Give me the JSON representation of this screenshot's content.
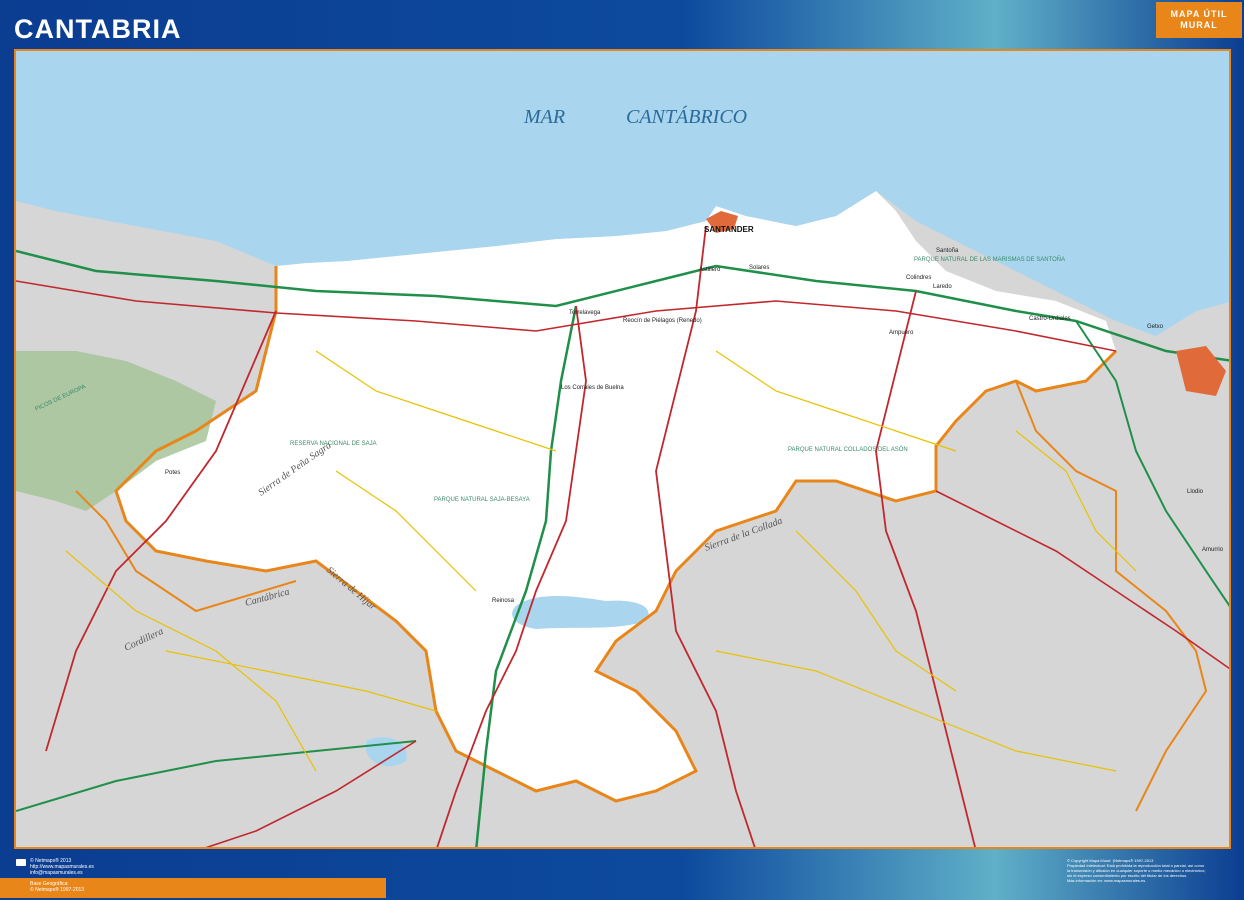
{
  "header": {
    "title": "CANTABRIA",
    "badge_line1": "MAPA ÚTIL",
    "badge_line2": "MURAL"
  },
  "map": {
    "sea_word1": "MAR",
    "sea_word2": "CANTÁBRICO",
    "capital": "SANTANDER",
    "towns": [
      "Torrelavega",
      "Los Corrales de Buelna",
      "Reinosa",
      "Laredo",
      "Castro-Urdiales",
      "Santoña",
      "Ampuero",
      "Getxo",
      "Llodio",
      "Amurrio",
      "Potes",
      "Reocín de Piélagos (Renedo)",
      "Astillero",
      "Colindres",
      "Solares"
    ],
    "park_labels": [
      "RESERVA NACIONAL DE SAJA",
      "PARQUE NATURAL SAJA-BESAYA",
      "PARQUE NATURAL COLLADOS DEL ASÓN",
      "PICOS DE EUROPA",
      "PARQUE NATURAL DE LAS MARISMAS DE SANTOÑA"
    ],
    "relief_labels": [
      "Cordillera",
      "Cantábrica",
      "Sierra de Peña Sagra",
      "Sierra de Híjar",
      "Sierra de la Collada"
    ],
    "colors": {
      "sea": "#a9d6ee",
      "cantabria": "#ffffff",
      "neighbour": "#d6d6d6",
      "border": "#e8861a",
      "road_main": "#c0282e",
      "road_secondary": "#e8c200",
      "motorway": "#1f8f4a",
      "park": "#a6c49a"
    }
  },
  "footer": {
    "left_lines": [
      "© Netmaps® 2013",
      "http://www.mapasmurales.es",
      "info@mapasmurales.es"
    ],
    "base_lines": [
      "Base Geográfica:",
      "© Netmaps® 1997-2013"
    ],
    "right_lines": [
      "© Copyright Mapa Mural ·(Netmaps® 1997-2013",
      "Propiedad Intelectual: Está prohibida la reproducción total o parcial, así como",
      "la transmisión y difusión en cualquier soporte o medio mecánico o electrónico;",
      "sin el expreso consentimiento por escrito del titular de los derechos.",
      "Más información en: www.mapasmurales.es"
    ]
  }
}
